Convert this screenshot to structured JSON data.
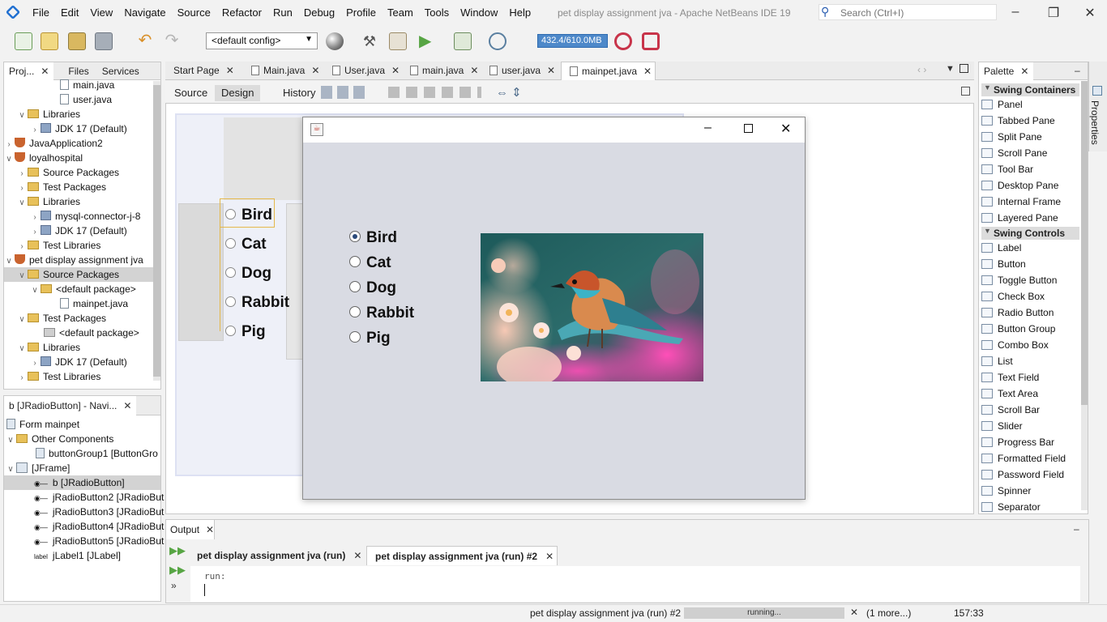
{
  "window": {
    "title": "pet display assignment jva - Apache NetBeans IDE 19"
  },
  "menu": [
    "File",
    "Edit",
    "View",
    "Navigate",
    "Source",
    "Refactor",
    "Run",
    "Debug",
    "Profile",
    "Team",
    "Tools",
    "Window",
    "Help"
  ],
  "search": {
    "placeholder": "Search (Ctrl+I)"
  },
  "toolbar": {
    "config": "<default config>",
    "memory": "432.4/610.0MB"
  },
  "projects_panel": {
    "tabs": [
      "Proj...",
      "Files",
      "Services"
    ],
    "tree": [
      {
        "label": "main.java",
        "type": "file"
      },
      {
        "label": "user.java",
        "type": "file"
      },
      {
        "label": "Libraries",
        "type": "folder"
      },
      {
        "label": "JDK 17 (Default)",
        "type": "jar"
      },
      {
        "label": "JavaApplication2",
        "type": "project"
      },
      {
        "label": "loyalhospital",
        "type": "project"
      },
      {
        "label": "Source Packages",
        "type": "folder"
      },
      {
        "label": "Test Packages",
        "type": "folder"
      },
      {
        "label": "Libraries",
        "type": "folder"
      },
      {
        "label": "mysql-connector-j-8",
        "type": "jar"
      },
      {
        "label": "JDK 17 (Default)",
        "type": "jar"
      },
      {
        "label": "Test Libraries",
        "type": "folder"
      },
      {
        "label": "pet display assignment jva",
        "type": "project"
      },
      {
        "label": "Source Packages",
        "type": "folder"
      },
      {
        "label": "<default package>",
        "type": "package"
      },
      {
        "label": "mainpet.java",
        "type": "file"
      },
      {
        "label": "Test Packages",
        "type": "folder"
      },
      {
        "label": "<default package>",
        "type": "package"
      },
      {
        "label": "Libraries",
        "type": "folder"
      },
      {
        "label": "JDK 17 (Default)",
        "type": "jar"
      },
      {
        "label": "Test Libraries",
        "type": "folder"
      }
    ]
  },
  "navigator": {
    "title": "b [JRadioButton] - Navi...",
    "items": [
      "Form mainpet",
      "Other Components",
      "buttonGroup1 [ButtonGro",
      "[JFrame]",
      "b [JRadioButton]",
      "jRadioButton2 [JRadioBut",
      "jRadioButton3 [JRadioBut",
      "jRadioButton4 [JRadioBut",
      "jRadioButton5 [JRadioBut",
      "jLabel1 [JLabel]"
    ]
  },
  "editor": {
    "tabs": [
      "Start Page",
      "Main.java",
      "User.java",
      "main.java",
      "user.java",
      "mainpet.java"
    ],
    "views": [
      "Source",
      "Design",
      "History"
    ]
  },
  "form": {
    "options": [
      "Bird",
      "Cat",
      "Dog",
      "Rabbit",
      "Pig"
    ],
    "selected": "Bird"
  },
  "palette": {
    "title": "Palette",
    "side_tab": "Properties",
    "containers_title": "Swing Containers",
    "containers": [
      "Panel",
      "Tabbed Pane",
      "Split Pane",
      "Scroll Pane",
      "Tool Bar",
      "Desktop Pane",
      "Internal Frame",
      "Layered Pane"
    ],
    "controls_title": "Swing Controls",
    "controls": [
      "Label",
      "Button",
      "Toggle Button",
      "Check Box",
      "Radio Button",
      "Button Group",
      "Combo Box",
      "List",
      "Text Field",
      "Text Area",
      "Scroll Bar",
      "Slider",
      "Progress Bar",
      "Formatted Field",
      "Password Field",
      "Spinner",
      "Separator"
    ]
  },
  "output": {
    "title": "Output",
    "tabs": [
      "pet display assignment jva (run)",
      "pet display assignment jva (run) #2"
    ],
    "text": "run:"
  },
  "status": {
    "task": "pet display assignment jva (run) #2",
    "progress": "running...",
    "more": "(1 more...)",
    "position": "157:33"
  }
}
